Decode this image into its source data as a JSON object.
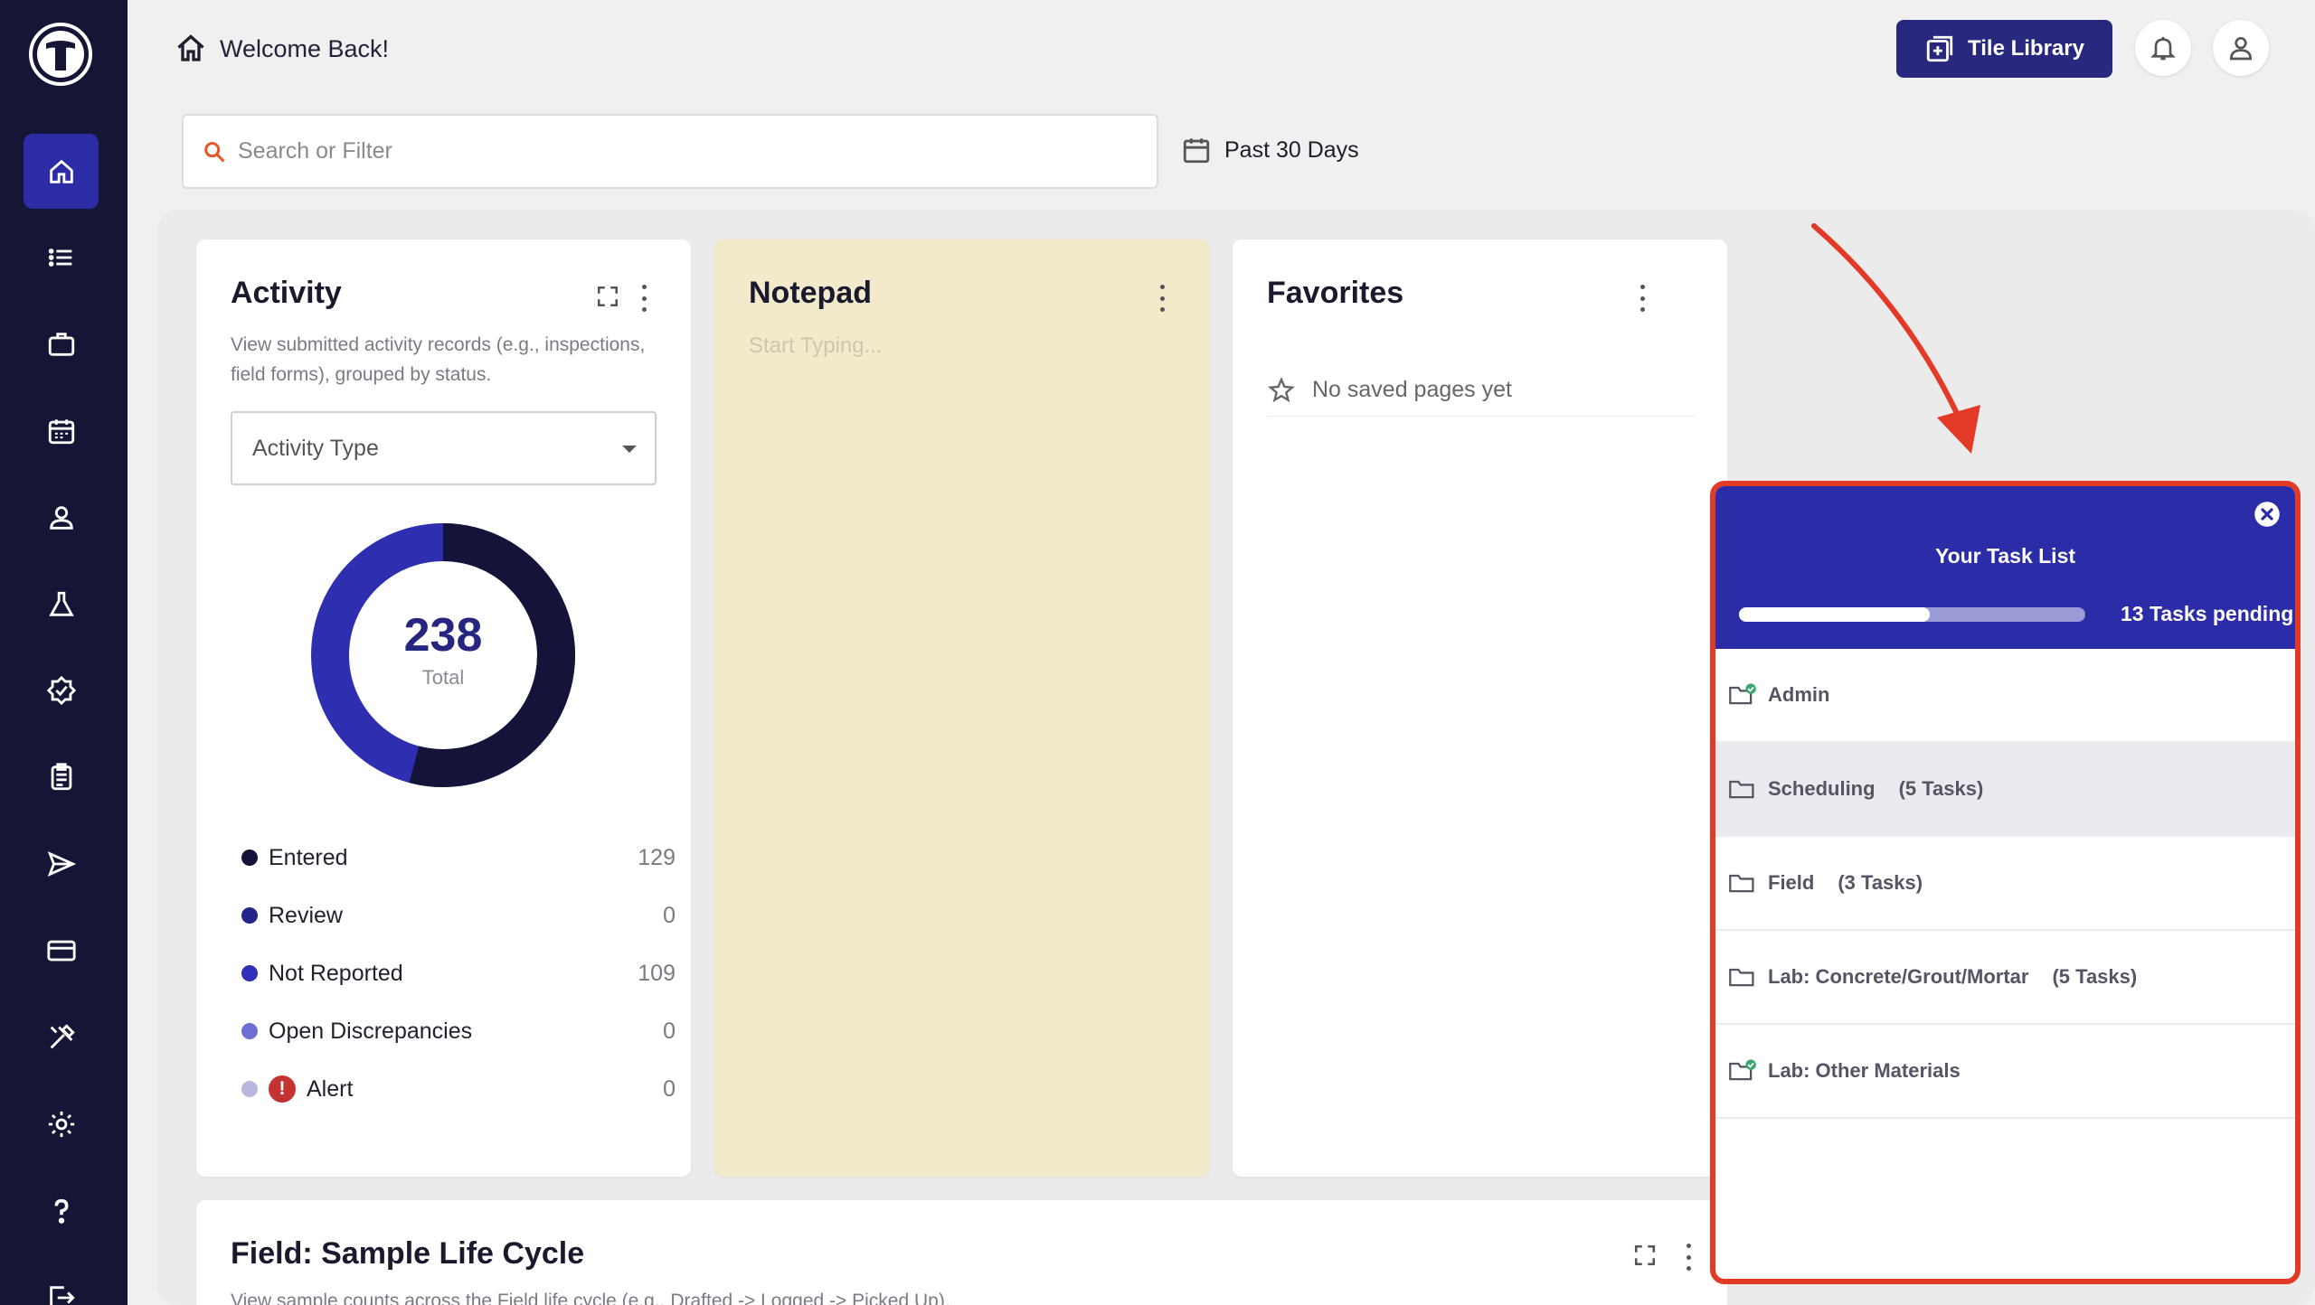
{
  "header": {
    "welcome": "Welcome Back!",
    "tile_library_label": "Tile Library"
  },
  "search": {
    "placeholder": "Search or Filter",
    "value": ""
  },
  "date_filter": {
    "label": "Past 30 Days"
  },
  "sidebar": {
    "items": [
      {
        "icon": "home-icon",
        "active": true
      },
      {
        "icon": "list-icon",
        "active": false
      },
      {
        "icon": "briefcase-icon",
        "active": false
      },
      {
        "icon": "calendar-icon",
        "active": false
      },
      {
        "icon": "user-icon",
        "active": false
      },
      {
        "icon": "flask-icon",
        "active": false
      },
      {
        "icon": "check-badge-icon",
        "active": false
      },
      {
        "icon": "clipboard-icon",
        "active": false
      },
      {
        "icon": "send-icon",
        "active": false
      },
      {
        "icon": "credit-card-icon",
        "active": false
      },
      {
        "icon": "tools-icon",
        "active": false
      },
      {
        "icon": "gear-icon",
        "active": false
      },
      {
        "icon": "help-icon",
        "active": false
      },
      {
        "icon": "logout-icon",
        "active": false
      }
    ]
  },
  "activity": {
    "title": "Activity",
    "description": "View submitted activity records (e.g., inspections, field forms), grouped by status.",
    "select_value": "Activity Type",
    "total": "238",
    "total_label": "Total",
    "legend": [
      {
        "label": "Entered",
        "count": "129",
        "color": "#14143a"
      },
      {
        "label": "Review",
        "count": "0",
        "color": "#24248a"
      },
      {
        "label": "Not Reported",
        "count": "109",
        "color": "#3030b8"
      },
      {
        "label": "Open Discrepancies",
        "count": "0",
        "color": "#6e6ed2"
      },
      {
        "label": "Alert",
        "count": "0",
        "color": "#b8b8de"
      }
    ],
    "alert_icon_text": "!"
  },
  "notepad": {
    "title": "Notepad",
    "placeholder": "Start Typing..."
  },
  "favorites": {
    "title": "Favorites",
    "empty_text": "No saved pages yet"
  },
  "lower_card": {
    "title": "Field: Sample Life Cycle",
    "description": "View sample counts across the Field life cycle (e.g., Drafted -> Logged -> Picked Up)."
  },
  "task_list": {
    "title": "Your Task List",
    "pending": "13 Tasks pending",
    "progress": 0.55,
    "items": [
      {
        "label": "Admin",
        "count": "",
        "complete": true
      },
      {
        "label": "Scheduling",
        "count": "(5 Tasks)",
        "complete": false
      },
      {
        "label": "Field",
        "count": "(3 Tasks)",
        "complete": false
      },
      {
        "label": "Lab: Concrete/Grout/Mortar",
        "count": "(5 Tasks)",
        "complete": false
      },
      {
        "label": "Lab: Other Materials",
        "count": "",
        "complete": true
      }
    ]
  },
  "colors": {
    "sidebar_bg": "#151535",
    "accent": "#2b2ca6",
    "highlight_border": "#e23a27",
    "notepad_bg": "#f3e9cb"
  }
}
